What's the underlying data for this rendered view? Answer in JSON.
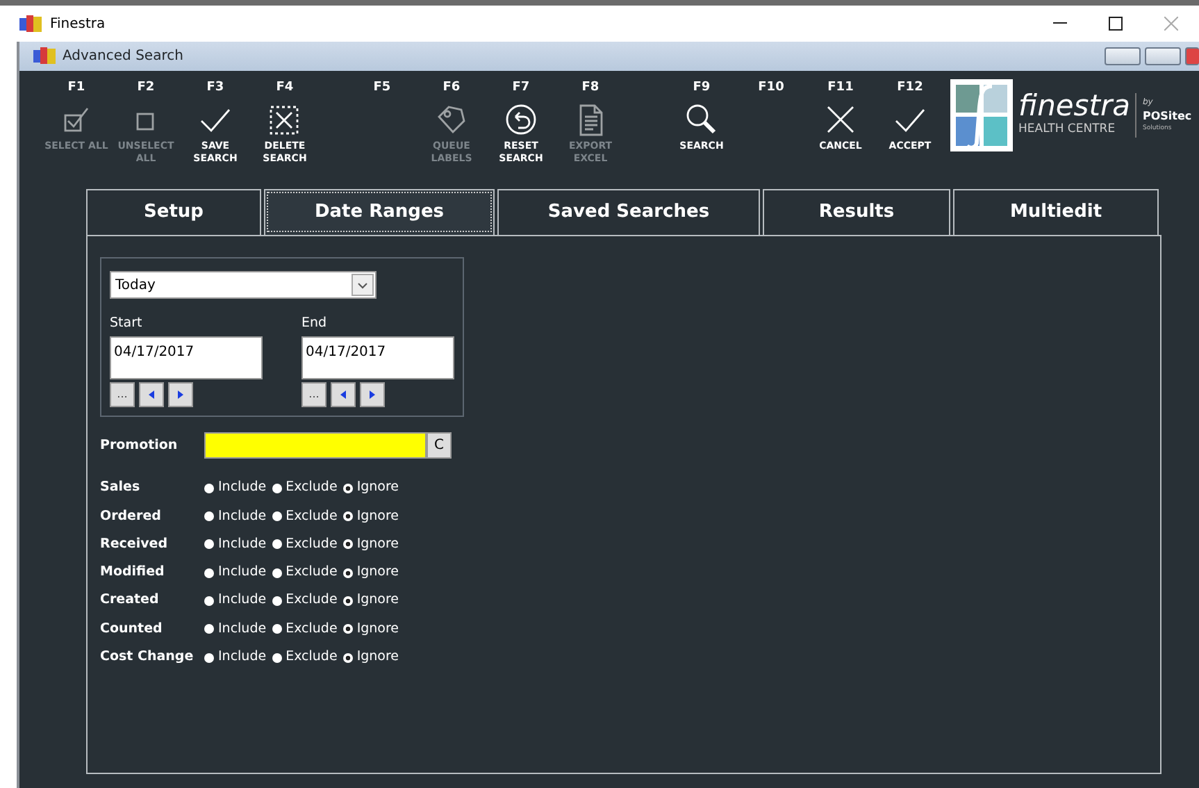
{
  "app_window": {
    "title": "Finestra"
  },
  "dialog": {
    "title": "Advanced Search"
  },
  "toolbar": [
    {
      "key": "F1",
      "label": "SELECT ALL",
      "kind": "checkbox",
      "disabled": true
    },
    {
      "key": "F2",
      "label": "UNSELECT ALL",
      "kind": "square",
      "disabled": true
    },
    {
      "key": "F3",
      "label": "SAVE SEARCH",
      "kind": "check",
      "disabled": false
    },
    {
      "key": "F4",
      "label": "DELETE SEARCH",
      "kind": "xbox",
      "disabled": false
    },
    {
      "key": "F5"
    },
    {
      "key": "F6",
      "label": "QUEUE LABELS",
      "kind": "tag",
      "disabled": true
    },
    {
      "key": "F7",
      "label": "RESET SEARCH",
      "kind": "undo",
      "disabled": false
    },
    {
      "key": "F8",
      "label": "EXPORT EXCEL",
      "kind": "doc",
      "disabled": true
    },
    {
      "key": "F9",
      "label": "SEARCH",
      "kind": "search",
      "disabled": false
    },
    {
      "key": "F10"
    },
    {
      "key": "F11",
      "label": "CANCEL",
      "kind": "x",
      "disabled": false
    },
    {
      "key": "F12",
      "label": "ACCEPT",
      "kind": "check",
      "disabled": false
    }
  ],
  "logo": {
    "name": "finestra",
    "subtitle": "HEALTH CENTRE",
    "by": "by",
    "maker": "POSitec",
    "maker_sub": "Solutions"
  },
  "tabs": [
    {
      "label": "Setup",
      "selected": false
    },
    {
      "label": "Date Ranges",
      "selected": true
    },
    {
      "label": "Saved Searches",
      "selected": false
    },
    {
      "label": "Results",
      "selected": false
    },
    {
      "label": "Multiedit",
      "selected": false
    }
  ],
  "date_range": {
    "preset": "Today",
    "start": {
      "label": "Start",
      "value": "04/17/2017",
      "button": "..."
    },
    "end": {
      "label": "End",
      "value": "04/17/2017",
      "button": "..."
    }
  },
  "promotion": {
    "label": "Promotion",
    "clear_button": "C"
  },
  "filters": [
    {
      "label": "Sales",
      "options": [
        {
          "label": "Include",
          "selected": false
        },
        {
          "label": "Exclude",
          "selected": false
        },
        {
          "label": "Ignore",
          "selected": true
        }
      ]
    },
    {
      "label": "Ordered",
      "options": [
        {
          "label": "Include",
          "selected": false
        },
        {
          "label": "Exclude",
          "selected": false
        },
        {
          "label": "Ignore",
          "selected": true
        }
      ]
    },
    {
      "label": "Received",
      "options": [
        {
          "label": "Include",
          "selected": false
        },
        {
          "label": "Exclude",
          "selected": false
        },
        {
          "label": "Ignore",
          "selected": true
        }
      ]
    },
    {
      "label": "Modified",
      "options": [
        {
          "label": "Include",
          "selected": false
        },
        {
          "label": "Exclude",
          "selected": false
        },
        {
          "label": "Ignore",
          "selected": true
        }
      ]
    },
    {
      "label": "Created",
      "options": [
        {
          "label": "Include",
          "selected": false
        },
        {
          "label": "Exclude",
          "selected": false
        },
        {
          "label": "Ignore",
          "selected": true
        }
      ]
    },
    {
      "label": "Counted",
      "options": [
        {
          "label": "Include",
          "selected": false
        },
        {
          "label": "Exclude",
          "selected": false
        },
        {
          "label": "Ignore",
          "selected": true
        }
      ]
    },
    {
      "label": "Cost Change",
      "options": [
        {
          "label": "Include",
          "selected": false
        },
        {
          "label": "Exclude",
          "selected": false
        },
        {
          "label": "Ignore",
          "selected": true
        }
      ]
    }
  ]
}
